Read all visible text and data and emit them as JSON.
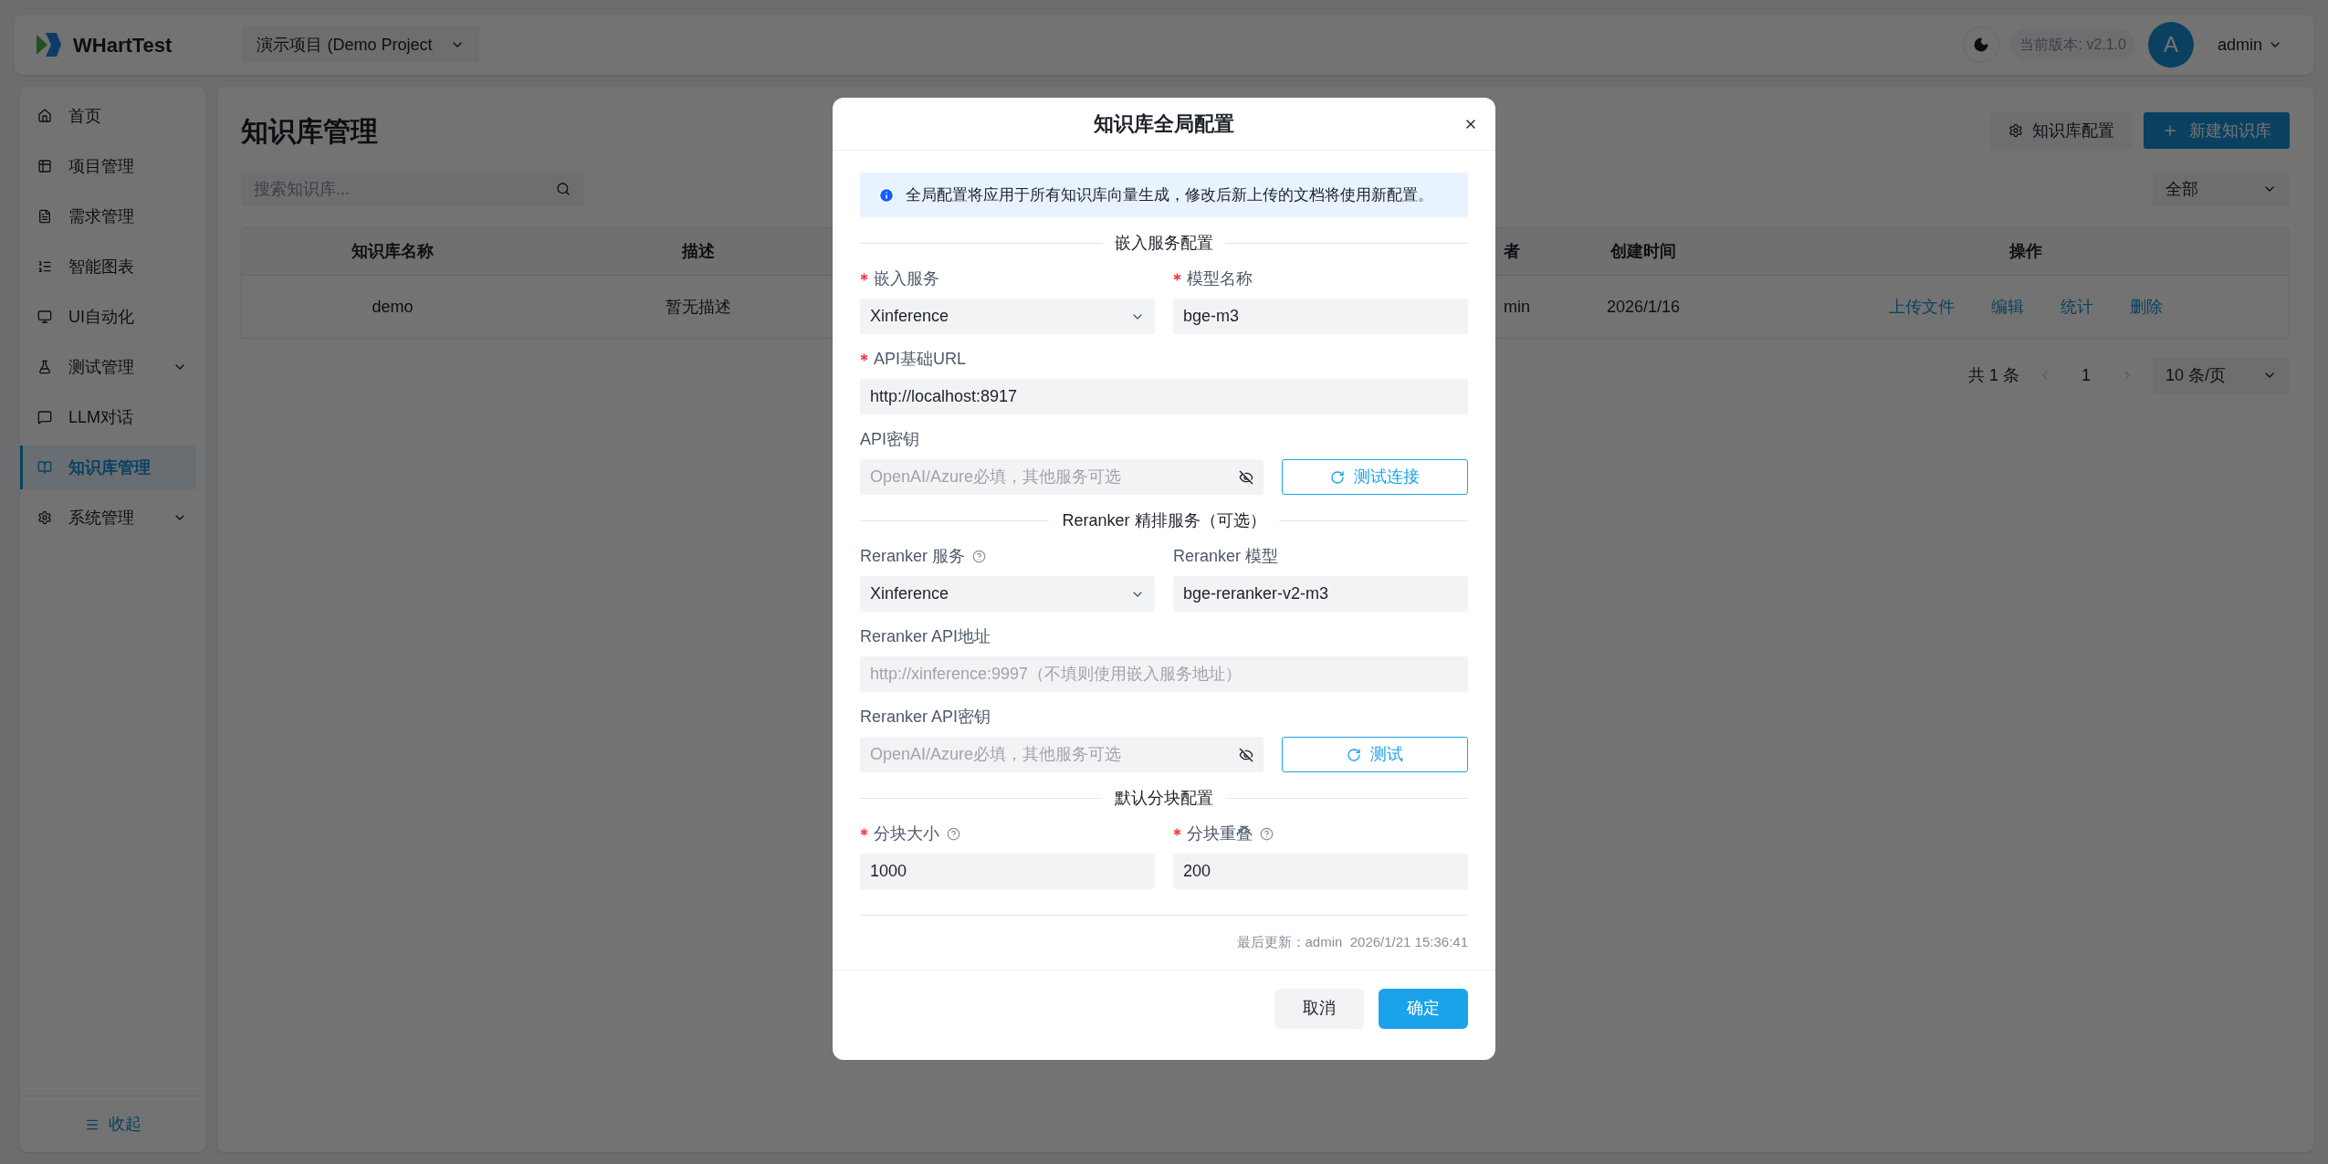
{
  "app": {
    "name": "WHartTest"
  },
  "project_select": {
    "value": "演示项目 (Demo Project"
  },
  "header": {
    "version": "当前版本: v2.1.0",
    "avatar_letter": "A",
    "user": "admin"
  },
  "sidebar": {
    "items": [
      {
        "label": "首页",
        "selected": false
      },
      {
        "label": "项目管理",
        "selected": false
      },
      {
        "label": "需求管理",
        "selected": false
      },
      {
        "label": "智能图表",
        "selected": false
      },
      {
        "label": "UI自动化",
        "selected": false
      },
      {
        "label": "测试管理",
        "selected": false,
        "expanded": false
      },
      {
        "label": "LLM对话",
        "selected": false
      },
      {
        "label": "知识库管理",
        "selected": true
      },
      {
        "label": "系统管理",
        "selected": false,
        "expanded": false
      }
    ],
    "collapse_label": "收起"
  },
  "page": {
    "title": "知识库管理",
    "config_button": "知识库配置",
    "new_button": "新建知识库",
    "search": {
      "placeholder": "搜索知识库..."
    },
    "filter": {
      "value": "全部"
    },
    "table": {
      "columns": [
        "知识库名称",
        "描述",
        "者",
        "创建时间",
        "操作"
      ],
      "rows": [
        {
          "cells": [
            "demo",
            "暂无描述",
            "min",
            "2026/1/16"
          ],
          "actions": [
            "上传文件",
            "编辑",
            "统计",
            "删除"
          ]
        }
      ]
    },
    "pagination": {
      "total": "共 1 条",
      "page": "1",
      "page_size": "10 条/页"
    }
  },
  "dialog": {
    "title": "知识库全局配置",
    "info": "全局配置将应用于所有知识库向量生成，修改后新上传的文档将使用新配置。",
    "sections": [
      {
        "title": "嵌入服务配置",
        "rows": [
          [
            {
              "label": "嵌入服务",
              "required": true,
              "help": false,
              "kind": "select",
              "value": "Xinference"
            },
            {
              "label": "模型名称",
              "required": true,
              "help": false,
              "kind": "text",
              "value": "bge-m3"
            }
          ],
          [
            {
              "label": "API基础URL",
              "required": true,
              "help": false,
              "kind": "text",
              "value": "http://localhost:8917"
            }
          ],
          [
            {
              "label": "API密钥",
              "required": false,
              "help": false,
              "kind": "password",
              "placeholder": "OpenAI/Azure必填，其他服务可选",
              "action": "测试连接"
            }
          ]
        ]
      },
      {
        "title": "Reranker 精排服务（可选）",
        "rows": [
          [
            {
              "label": "Reranker 服务",
              "required": false,
              "help": true,
              "kind": "select",
              "value": "Xinference"
            },
            {
              "label": "Reranker 模型",
              "required": false,
              "help": false,
              "kind": "text",
              "value": "bge-reranker-v2-m3"
            }
          ],
          [
            {
              "label": "Reranker API地址",
              "required": false,
              "help": false,
              "kind": "text",
              "placeholder": "http://xinference:9997（不填则使用嵌入服务地址）"
            }
          ],
          [
            {
              "label": "Reranker API密钥",
              "required": false,
              "help": false,
              "kind": "password",
              "placeholder": "OpenAI/Azure必填，其他服务可选",
              "action": "测试"
            }
          ]
        ]
      },
      {
        "title": "默认分块配置",
        "rows": [
          [
            {
              "label": "分块大小",
              "required": true,
              "help": true,
              "kind": "text",
              "value": "1000"
            },
            {
              "label": "分块重叠",
              "required": true,
              "help": true,
              "kind": "text",
              "value": "200"
            }
          ]
        ]
      }
    ],
    "last_updated": "最后更新：admin  2026/1/21 15:36:41",
    "buttons": [
      {
        "label": "取消",
        "kind": "secondary"
      },
      {
        "label": "确定",
        "kind": "primary"
      }
    ]
  }
}
